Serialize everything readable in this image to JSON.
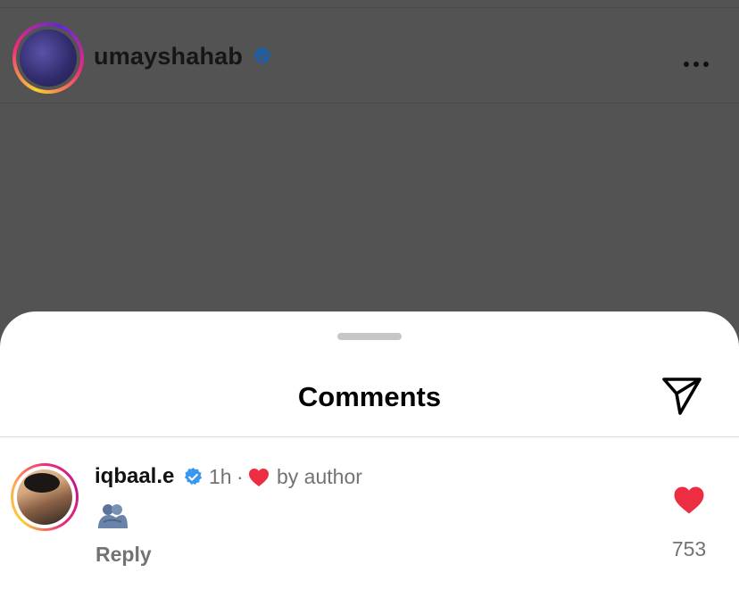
{
  "post": {
    "username": "umayshahab",
    "verified_icon": "verified-badge-icon",
    "more_icon": "more-options-icon"
  },
  "sheet": {
    "title": "Comments",
    "share_icon": "send-icon"
  },
  "comments": [
    {
      "username": "iqbaal.e",
      "verified": true,
      "time": "1h",
      "separator": "·",
      "liked_by_author_label": "by author",
      "content_emoji": "people-hugging-emoji",
      "reply_label": "Reply",
      "like_count": "753"
    }
  ],
  "colors": {
    "heart": "#ed2d41",
    "verified": "#3897f0",
    "secondary_text": "#737373",
    "backdrop": "#535353"
  }
}
